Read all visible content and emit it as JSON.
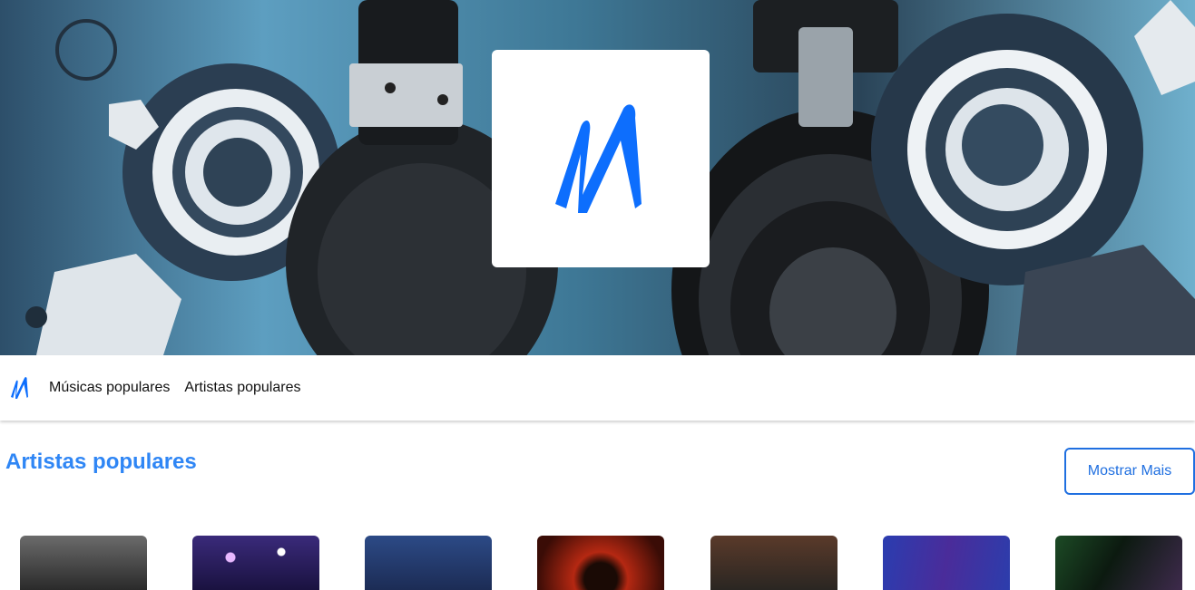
{
  "hero": {
    "logo_icon": "m-logo-icon",
    "brand_color": "#0d6efd"
  },
  "nav": {
    "logo_icon": "m-logo-icon",
    "links": [
      "Músicas populares",
      "Artistas populares"
    ]
  },
  "section": {
    "title": "Artistas populares",
    "more_button": "Mostrar Mais",
    "accent_color": "#2f86f5"
  },
  "artists": [
    {
      "thumb_style": "monochrome-duo"
    },
    {
      "thumb_style": "stage-lights-purple"
    },
    {
      "thumb_style": "blue-duo"
    },
    {
      "thumb_style": "red-glow"
    },
    {
      "thumb_style": "dark-stage"
    },
    {
      "thumb_style": "blue-lasers"
    },
    {
      "thumb_style": "green-lasers"
    }
  ]
}
